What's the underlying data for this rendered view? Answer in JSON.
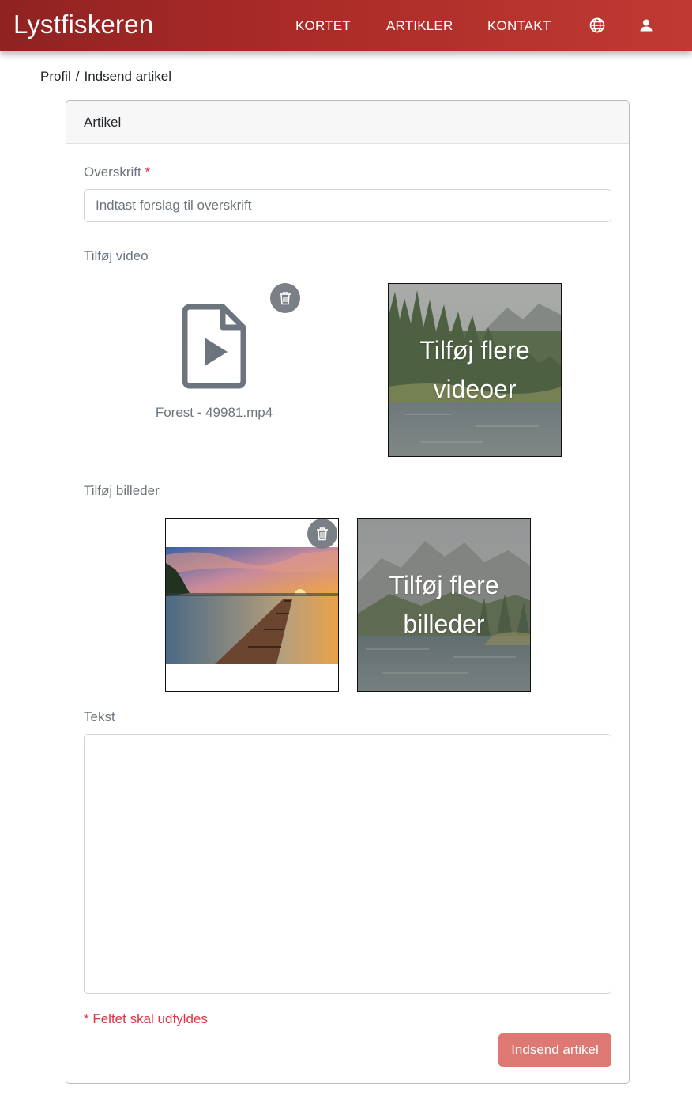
{
  "brand": "Lystfiskeren",
  "nav": {
    "kortet": "KORTET",
    "artikler": "ARTIKLER",
    "kontakt": "KONTAKT",
    "language_icon": "globe-icon",
    "profile_icon": "user-icon"
  },
  "breadcrumb": {
    "items": [
      "Profil",
      "Indsend artikel"
    ],
    "separator": "/"
  },
  "card": {
    "title": "Artikel",
    "headline": {
      "label": "Overskrift",
      "required_marker": "*",
      "placeholder": "Indtast forslag til overskrift",
      "value": ""
    },
    "video": {
      "label": "Tilføj video",
      "file_name": "Forest - 49981.mp4",
      "file_icon": "video-file-icon",
      "delete_icon": "trash-icon",
      "add_more_label": "Tilføj flere videoer"
    },
    "images": {
      "label": "Tilføj billeder",
      "delete_icon": "trash-icon",
      "add_more_label": "Tilføj flere billeder"
    },
    "text": {
      "label": "Tekst",
      "value": ""
    },
    "required_note": "* Feltet skal udfyldes",
    "submit_label": "Indsend artikel"
  },
  "colors": {
    "navbar_start": "#8f2222",
    "navbar_end": "#c03a33",
    "required": "#dc3545",
    "submit_button": "#dd7873",
    "muted_text": "#6c757d",
    "delete_button": "#7a8086"
  }
}
